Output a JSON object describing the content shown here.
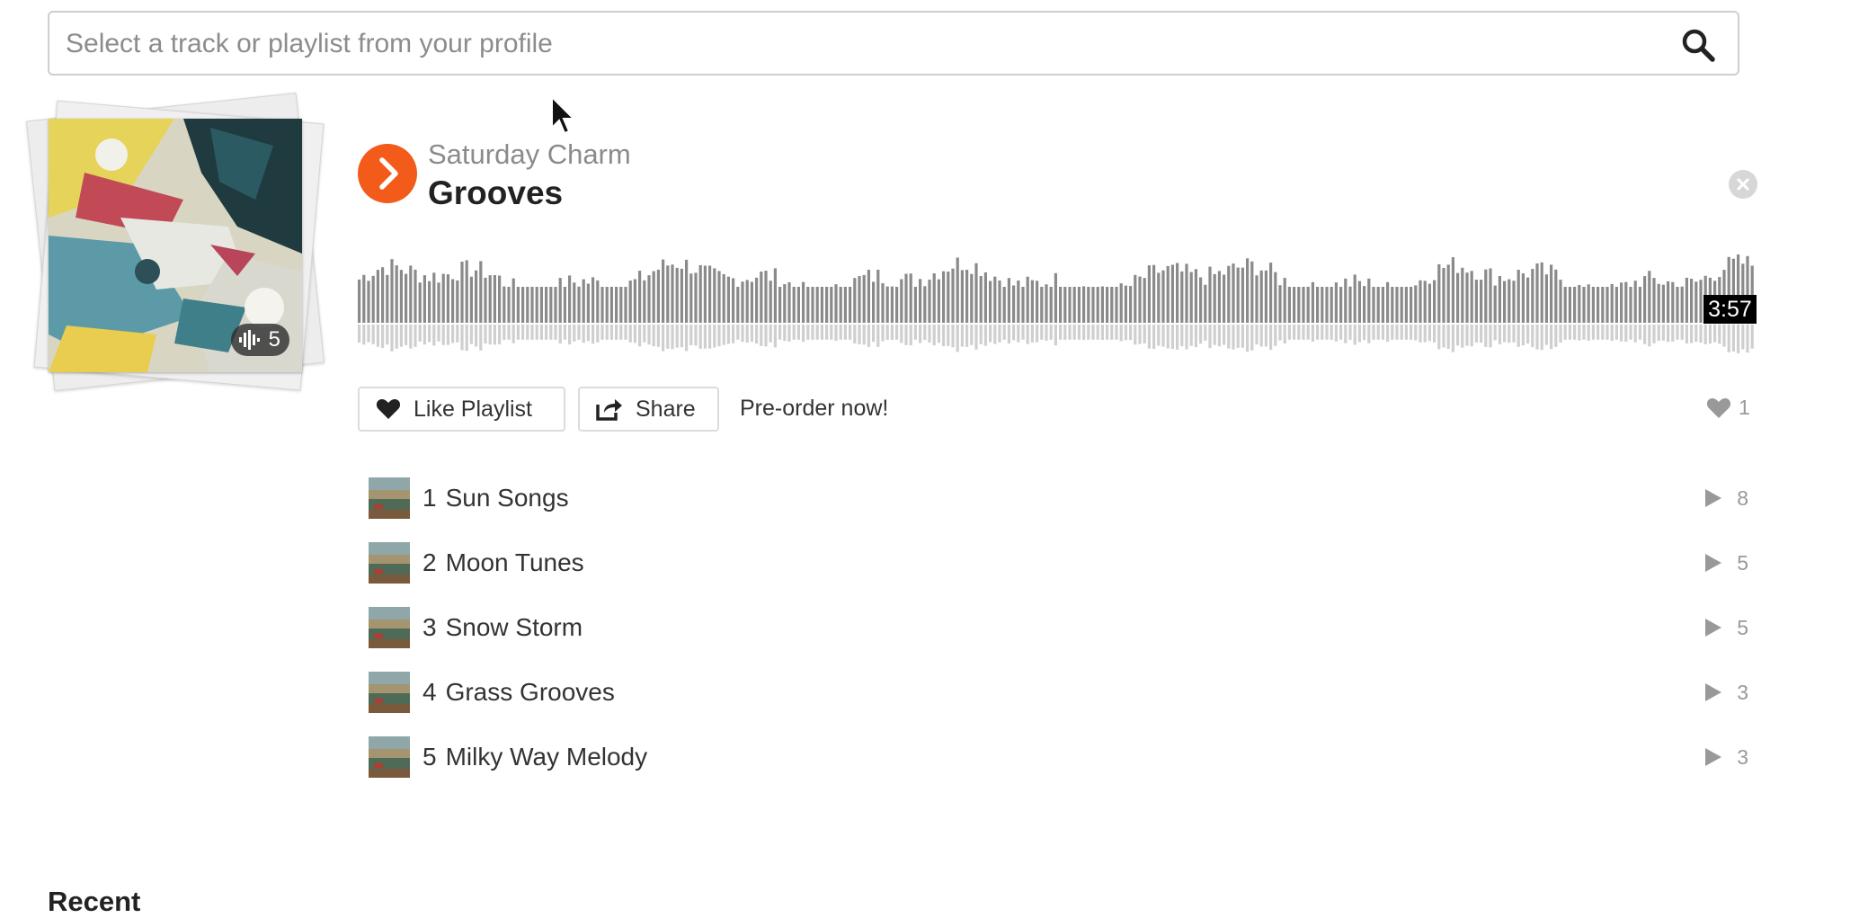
{
  "search": {
    "placeholder": "Select a track or playlist from your profile"
  },
  "playlist": {
    "artist": "Saturday Charm",
    "title": "Grooves",
    "track_count": "5",
    "duration": "3:57",
    "like_label": "Like Playlist",
    "share_label": "Share",
    "preorder_label": "Pre-order now!",
    "like_count": "1"
  },
  "tracks": [
    {
      "num": "1",
      "title": "Sun Songs",
      "plays": "8"
    },
    {
      "num": "2",
      "title": "Moon Tunes",
      "plays": "5"
    },
    {
      "num": "3",
      "title": "Snow Storm",
      "plays": "5"
    },
    {
      "num": "4",
      "title": "Grass Grooves",
      "plays": "3"
    },
    {
      "num": "5",
      "title": "Milky Way Melody",
      "plays": "3"
    }
  ],
  "sections": {
    "recent": "Recent"
  },
  "colors": {
    "accent": "#f25b1a",
    "waveform": "#8a8a8a",
    "waveform_reflection": "#cfcfcf"
  },
  "icons": {
    "search": "search-icon",
    "play": "play-icon",
    "close": "close-icon",
    "heart": "heart-icon",
    "share": "share-icon",
    "waveform_badge": "waveform-icon"
  }
}
